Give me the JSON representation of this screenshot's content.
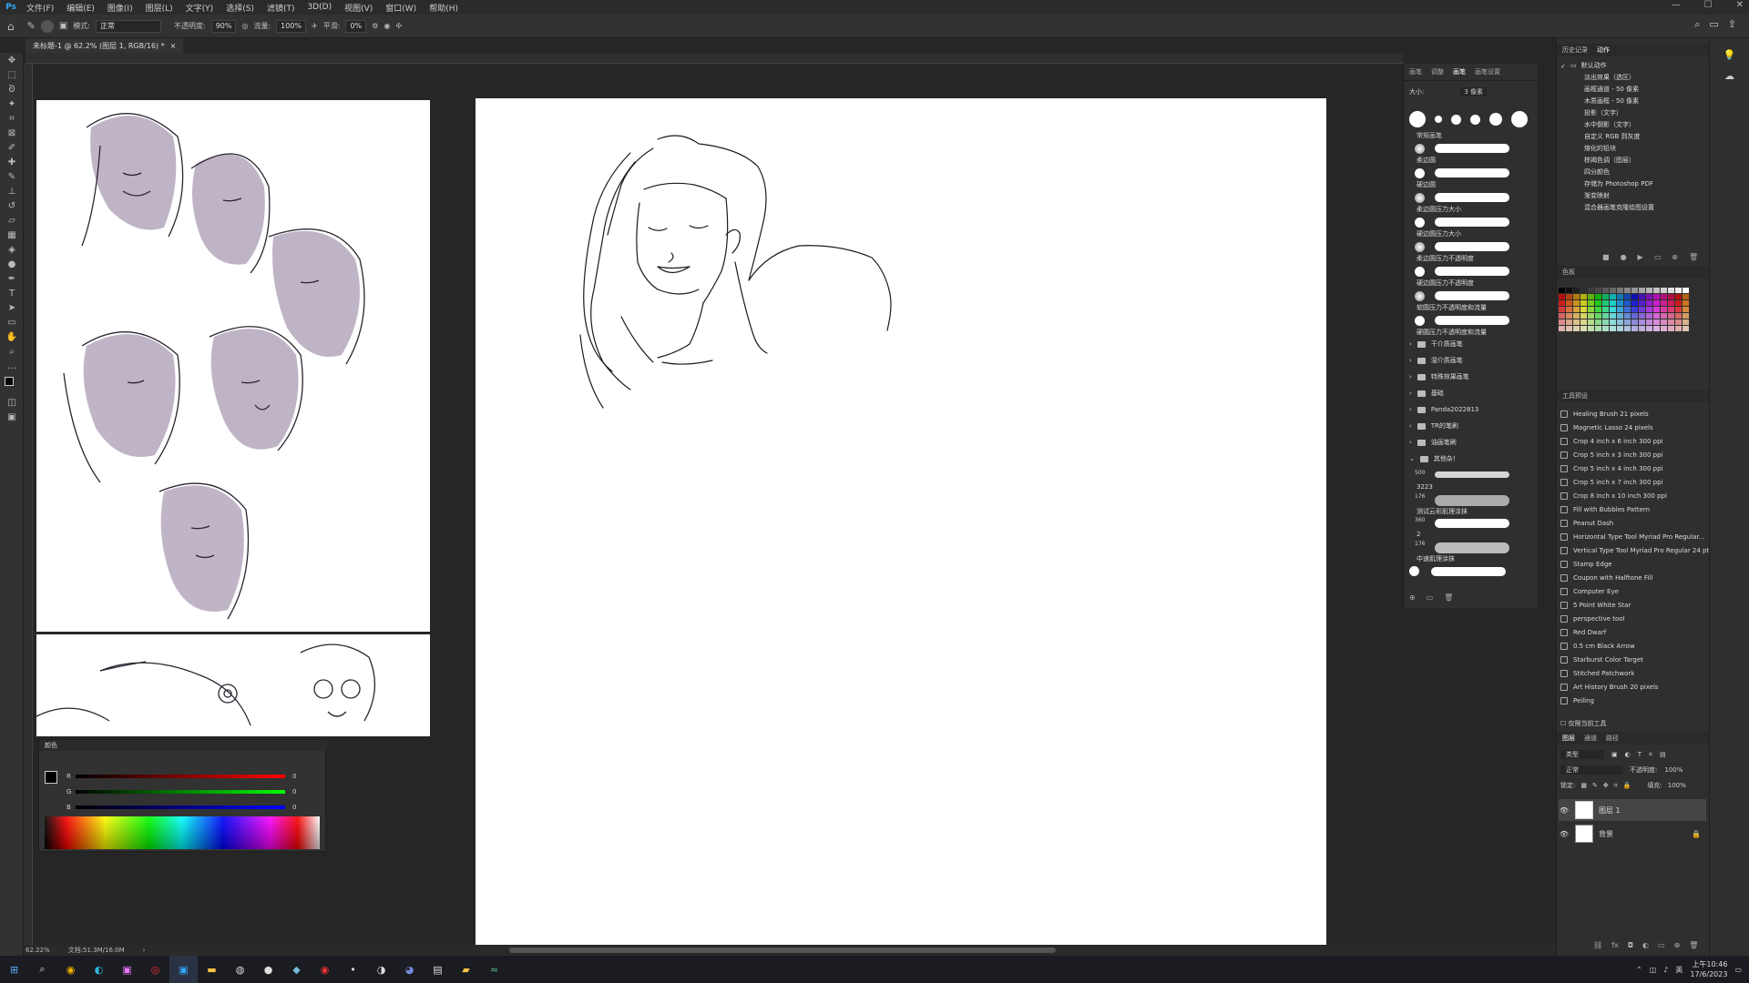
{
  "menubar": {
    "logo": "Ps",
    "items": [
      "文件(F)",
      "编辑(E)",
      "图像(I)",
      "图层(L)",
      "文字(Y)",
      "选择(S)",
      "滤镜(T)",
      "3D(D)",
      "视图(V)",
      "窗口(W)",
      "帮助(H)"
    ],
    "window_controls": [
      "—",
      "☐",
      "✕"
    ]
  },
  "options": {
    "mode_label": "模式:",
    "mode_value": "正常",
    "opacity_label": "不透明度:",
    "opacity_value": "90%",
    "flow_label": "流量:",
    "flow_value": "100%",
    "smooth_label": "平滑:",
    "smooth_value": "0%"
  },
  "document_tab": {
    "title": "未标题-1 @ 62.2% (图层 1, RGB/16) *",
    "close": "×"
  },
  "color_panel": {
    "title": "颜色",
    "r_label": "R",
    "g_label": "G",
    "b_label": "B",
    "r_value": "0",
    "g_value": "0",
    "b_value": "0"
  },
  "brush_panel": {
    "tabs": [
      "画笔",
      "调整",
      "画笔",
      "画笔设置"
    ],
    "size_label": "大小:",
    "size_value": "3 像素",
    "presets_header": "常规画笔",
    "brushes": [
      "柔边圆",
      "硬边圆",
      "柔边圆压力大小",
      "硬边圆压力大小",
      "柔边圆压力不透明度",
      "硬边圆压力不透明度",
      "软圆压力不透明度和流量",
      "硬圆压力不透明度和流量"
    ],
    "folders": [
      "干介质画笔",
      "湿介质画笔",
      "特殊效果画笔",
      "基础",
      "Panda2022813",
      "TR的笔刷",
      "油画笔刷",
      "其他杂！"
    ],
    "custom_brushes": [
      {
        "size": "500",
        "name": "3223"
      },
      {
        "size": "176",
        "name": "测试云彩肌理涂抹"
      },
      {
        "size": "360",
        "name": "2"
      },
      {
        "size": "176",
        "name": "中速肌理涂抹"
      }
    ]
  },
  "actions_panel": {
    "tabs": [
      "历史记录",
      "动作"
    ],
    "items": [
      "默认动作",
      "淡出效果（选区）",
      "画框通道 - 50 像素",
      "木质画框 - 50 像素",
      "投影（文字）",
      "水中倒影（文字）",
      "自定义 RGB 到灰度",
      "熔化的铅块",
      "棕褐色调（图层）",
      "四分颜色",
      "存储为 Photoshop PDF",
      "渐变映射",
      "混合器画笔克隆绘图设置"
    ]
  },
  "swatches_panel": {
    "title": "色板"
  },
  "tool_presets": {
    "title": "工具预设",
    "items": [
      "Healing Brush 21 pixels",
      "Magnetic Lasso 24 pixels",
      "Crop 4 inch x 6 inch 300 ppi",
      "Crop 5 inch x 3 inch 300 ppi",
      "Crop 5 inch x 4 inch 300 ppi",
      "Crop 5 inch x 7 inch 300 ppi",
      "Crop 8 inch x 10 inch 300 ppi",
      "Fill with Bubbles Pattern",
      "Peanut Dash",
      "Horizontal Type Tool Myriad Pro Regular...",
      "Vertical Type Tool Myriad Pro Regular 24 pt",
      "Stamp Edge",
      "Coupon with Halftone Fill",
      "Computer Eye",
      "5 Point White Star",
      "perspective tool",
      "Red Dwarf",
      "0.5 cm Black Arrow",
      "Starburst Color Target",
      "Stitched Patchwork",
      "Art History Brush 20 pixels",
      "Peiling"
    ],
    "footer": "仅限当前工具"
  },
  "layers_panel": {
    "tabs": [
      "图层",
      "通道",
      "路径"
    ],
    "filter": "类型",
    "blend_mode": "正常",
    "opacity_label": "不透明度:",
    "opacity_value": "100%",
    "lock_label": "锁定:",
    "fill_label": "填充:",
    "fill_value": "100%",
    "layers": [
      {
        "name": "图层 1",
        "selected": true
      },
      {
        "name": "背景",
        "locked": true
      }
    ]
  },
  "status": {
    "zoom": "62.22%",
    "doc_info": "文档:51.3M/16.0M"
  },
  "taskbar": {
    "apps": [
      "start-icon",
      "search-icon",
      "chrome-icon",
      "edge-icon",
      "premiere-icon",
      "clip-icon",
      "photoshop-icon",
      "explorer-icon",
      "obs-icon",
      "gd-icon",
      "app-icon",
      "netease-icon",
      "dot-icon",
      "steam-icon",
      "discord-icon",
      "tool-icon",
      "ln-icon",
      "app2-icon"
    ],
    "clock_time": "上午10:46",
    "clock_date": "17/6/2023"
  },
  "colors": {
    "ui_bg": "#262626",
    "panel_bg": "#2f2f2f",
    "accent": "#31a8ff",
    "sketch_purple": "#9c8fa6"
  }
}
